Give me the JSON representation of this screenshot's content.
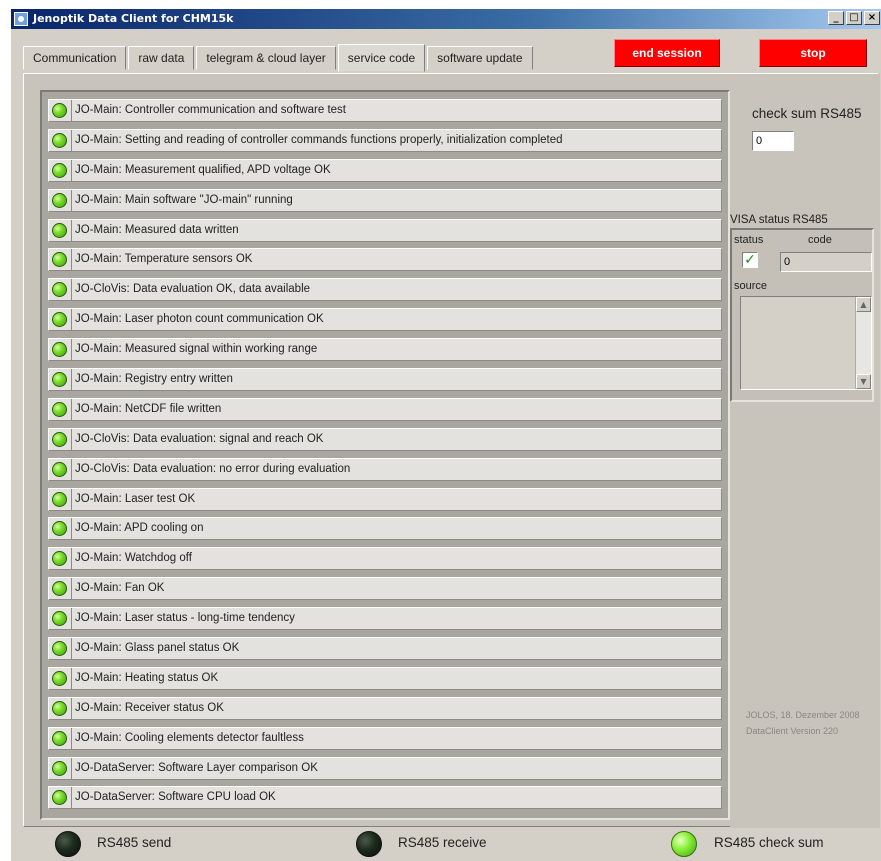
{
  "window": {
    "title": "Jenoptik Data Client for CHM15k",
    "controls": [
      "_",
      "□",
      "×"
    ]
  },
  "tabs": [
    {
      "label": "Communication",
      "active": false
    },
    {
      "label": "raw data",
      "active": false
    },
    {
      "label": "telegram & cloud layer",
      "active": false
    },
    {
      "label": "service code",
      "active": true
    },
    {
      "label": "software update",
      "active": false
    }
  ],
  "buttons": {
    "end_session": "end session",
    "stop": "stop"
  },
  "status_list": [
    "JO-Main: Controller communication and software test",
    "JO-Main: Setting and reading of controller commands functions properly, initialization completed",
    "JO-Main: Measurement qualified, APD voltage OK",
    "JO-Main: Main software \"JO-main\" running",
    "JO-Main: Measured data written",
    "JO-Main: Temperature sensors OK",
    "JO-CloVis: Data evaluation OK, data available",
    "JO-Main: Laser photon count communication OK",
    "JO-Main: Measured signal within working range",
    "JO-Main: Registry entry written",
    "JO-Main: NetCDF file written",
    "JO-CloVis: Data evaluation: signal and reach OK",
    "JO-CloVis: Data evaluation: no error during evaluation",
    "JO-Main: Laser test OK",
    "JO-Main: APD cooling on",
    "JO-Main: Watchdog off",
    "JO-Main: Fan OK",
    "JO-Main: Laser status - long-time tendency",
    "JO-Main: Glass panel status OK",
    "JO-Main: Heating status OK",
    "JO-Main: Receiver status OK",
    "JO-Main: Cooling elements detector faultless",
    "JO-DataServer: Software Layer comparison OK",
    "JO-DataServer: Software CPU load OK"
  ],
  "checksum": {
    "label": "check sum RS485",
    "value": "0"
  },
  "visa": {
    "title": "VISA status RS485",
    "status_label": "status",
    "status_checked": true,
    "check_glyph": "✓",
    "code_label": "code",
    "code_value": "0",
    "source_label": "source",
    "source_value": ""
  },
  "version": {
    "line1": "JOLOS, 18. Dezember 2008",
    "line2": "DataClient Version 220"
  },
  "footer": [
    {
      "label": "RS485 send",
      "on": false
    },
    {
      "label": "RS485 receive",
      "on": false
    },
    {
      "label": "RS485 check sum",
      "on": true
    }
  ],
  "colors": {
    "led_on": "#7ce02a",
    "led_off": "#1c2a1c",
    "alert_button": "#ff0000"
  }
}
